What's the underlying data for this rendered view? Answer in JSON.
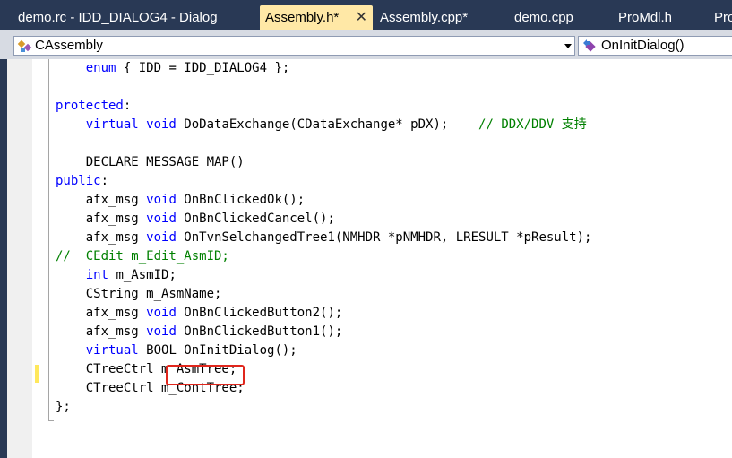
{
  "tabs": [
    {
      "label": "demo.rc - IDD_DIALOG4 - Dialog",
      "active": false
    },
    {
      "label": "Assembly.h*",
      "active": true,
      "close_icon": "close-icon"
    },
    {
      "label": "Assembly.cpp*",
      "active": false
    },
    {
      "label": "demo.cpp",
      "active": false
    },
    {
      "label": "ProMdl.h",
      "active": false
    },
    {
      "label": "Pro",
      "active": false
    }
  ],
  "nav": {
    "class_combo": {
      "icon": "class-icon",
      "value": "CAssembly"
    },
    "member_combo": {
      "icon": "method-icon",
      "value": "OnInitDialog()"
    }
  },
  "code_lines": [
    {
      "indent": "    ",
      "kw": "enum",
      "rest": " { IDD = IDD_DIALOG4 };",
      "comment": ""
    },
    {
      "indent": "",
      "kw": "",
      "rest": "",
      "comment": ""
    },
    {
      "indent": "",
      "kw": "protected",
      "rest": ":",
      "comment": ""
    },
    {
      "indent": "    ",
      "kw": "virtual void",
      "rest": " DoDataExchange(CDataExchange* pDX);    ",
      "comment": "// DDX/DDV 支持"
    },
    {
      "indent": "",
      "kw": "",
      "rest": "",
      "comment": ""
    },
    {
      "indent": "    ",
      "kw": "",
      "rest": "DECLARE_MESSAGE_MAP()",
      "comment": ""
    },
    {
      "indent": "",
      "kw": "public",
      "rest": ":",
      "comment": ""
    },
    {
      "indent": "    afx_msg ",
      "kw": "void",
      "rest": " OnBnClickedOk();",
      "comment": ""
    },
    {
      "indent": "    afx_msg ",
      "kw": "void",
      "rest": " OnBnClickedCancel();",
      "comment": ""
    },
    {
      "indent": "    afx_msg ",
      "kw": "void",
      "rest": " OnTvnSelchangedTree1(NMHDR *pNMHDR, LRESULT *pResult);",
      "comment": ""
    },
    {
      "indent": "",
      "kw": "",
      "rest": "",
      "comment": "//  CEdit m_Edit_AsmID;"
    },
    {
      "indent": "    ",
      "kw": "int",
      "rest": " m_AsmID;",
      "comment": ""
    },
    {
      "indent": "    ",
      "kw": "",
      "rest": "CString m_AsmName;",
      "comment": ""
    },
    {
      "indent": "    afx_msg ",
      "kw": "void",
      "rest": " OnBnClickedButton2();",
      "comment": ""
    },
    {
      "indent": "    afx_msg ",
      "kw": "void",
      "rest": " OnBnClickedButton1();",
      "comment": ""
    },
    {
      "indent": "    ",
      "kw": "virtual",
      "rest": " BOOL OnInitDialog();",
      "comment": ""
    },
    {
      "indent": "    ",
      "kw": "",
      "rest": "CTreeCtrl m_AsmTree;",
      "comment": ""
    },
    {
      "indent": "    ",
      "kw": "",
      "rest": "CTreeCtrl m_ContTree;",
      "comment": ""
    },
    {
      "indent": "",
      "kw": "",
      "rest": "};",
      "comment": ""
    }
  ],
  "colors": {
    "keyword": "#0000ff",
    "comment": "#008000",
    "active_tab": "#ffe8a6",
    "frame": "#293955",
    "annotation": "#e0261c"
  }
}
